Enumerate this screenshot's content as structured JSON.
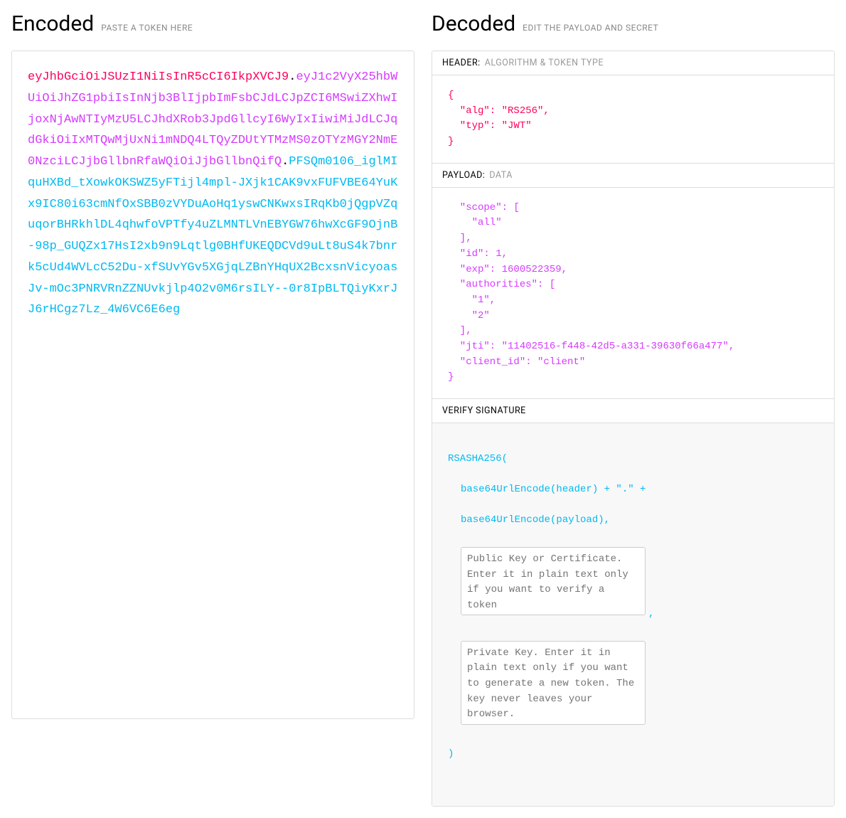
{
  "encoded": {
    "title": "Encoded",
    "subtitle": "PASTE A TOKEN HERE",
    "jwt_header": "eyJhbGciOiJSUzI1NiIsInR5cCI6IkpXVCJ9",
    "jwt_payload": "eyJ1c2VyX25hbWUiOiJhZG1pbiIsInNjb3BlIjpbImFsbCJdLCJpZCI6MSwiZXhwIjoxNjAwNTIyMzU5LCJhdXRob3JpdGllcyI6WyIxIiwiMiJdLCJqdGkiOiIxMTQwMjUxNi1mNDQ4LTQyZDUtYTMzMS0zOTYzMGY2NmE0NzciLCJjbGllbnRfaWQiOiJjbGllbnQifQ",
    "jwt_signature": "PFSQm0106_iglMIquHXBd_tXowkOKSWZ5yFTijl4mpl-JXjk1CAK9vxFUFVBE64YuKx9IC80i63cmNfOxSBB0zVYDuAoHq1yswCNKwxsIRqKb0jQgpVZquqorBHRkhlDL4qhwfoVPTfy4uZLMNTLVnEBYGW76hwXcGF9OjnB-98p_GUQZx17HsI2xb9n9Lqtlg0BHfUKEQDCVd9uLt8uS4k7bnrk5cUd4WVLcC52Du-xfSUvYGv5XGjqLZBnYHqUX2BcxsnVicyoasJv-mOc3PNRVRnZZNUvkjlp4O2v0M6rsILY--0r8IpBLTQiyKxrJJ6rHCgz7Lz_4W6VC6E6eg"
  },
  "decoded": {
    "title": "Decoded",
    "subtitle": "EDIT THE PAYLOAD AND SECRET",
    "header_section": {
      "title": "HEADER:",
      "desc": "ALGORITHM & TOKEN TYPE",
      "body": "{\n  \"alg\": \"RS256\",\n  \"typ\": \"JWT\"\n}"
    },
    "payload_section": {
      "title": "PAYLOAD:",
      "desc": "DATA",
      "body": "  \"scope\": [\n    \"all\"\n  ],\n  \"id\": 1,\n  \"exp\": 1600522359,\n  \"authorities\": [\n    \"1\",\n    \"2\"\n  ],\n  \"jti\": \"11402516-f448-42d5-a331-39630f66a477\",\n  \"client_id\": \"client\"\n}"
    },
    "verify_section": {
      "title": "VERIFY SIGNATURE",
      "algo_line": "RSASHA256(",
      "line1": "base64UrlEncode(header) + \".\" +",
      "line2": "base64UrlEncode(payload),",
      "public_key_placeholder": "Public Key or Certificate. Enter it in plain text only if you want to verify a token",
      "comma": ",",
      "private_key_placeholder": "Private Key. Enter it in plain text only if you want to generate a new token. The key never leaves your browser.",
      "close": ")"
    }
  }
}
